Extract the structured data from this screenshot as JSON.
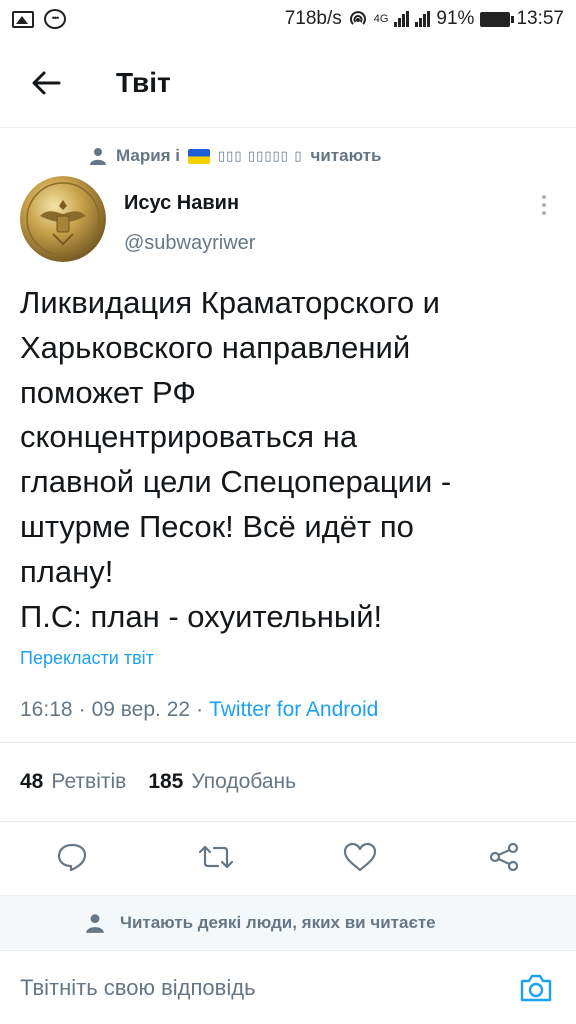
{
  "status_bar": {
    "speed": "718b/s",
    "network": "4G",
    "battery": "91%",
    "time": "13:57"
  },
  "header": {
    "title": "Твіт"
  },
  "social_context": {
    "name": "Мария і",
    "garbled": "▯▯▯ ▯▯▯▯▯ ▯",
    "suffix": "читають"
  },
  "tweet": {
    "author_name": "Исус Навин",
    "author_handle": "@subwayriwer",
    "text": "Ликвидация Краматорского и\nХарьковского направлений\nпоможет РФ\nсконцентрироваться на\nглавной цели Спецоперации -\nштурме Песок! Всё идёт по\nплану!\nП.С: план - охуительный!",
    "translate_label": "Перекласти твіт",
    "time": "16:18",
    "date": "09 вер. 22",
    "source": "Twitter for Android",
    "separator": "·"
  },
  "stats": {
    "retweets_count": "48",
    "retweets_label": "Ретвітів",
    "likes_count": "185",
    "likes_label": "Уподобань"
  },
  "followed_by": {
    "text": "Читають деякі люди, яких ви читаєте"
  },
  "reply": {
    "placeholder": "Твітніть свою відповідь"
  },
  "colors": {
    "accent": "#1da1f2",
    "secondary_text": "#657786",
    "primary_text": "#14171a",
    "divider": "#e6ecf0"
  },
  "icons": [
    "image-icon",
    "message-icon",
    "hotspot-icon",
    "signal-icon",
    "battery-icon",
    "back-arrow-icon",
    "person-icon",
    "more-vertical-icon",
    "reply-icon",
    "retweet-icon",
    "like-icon",
    "share-icon",
    "camera-icon"
  ]
}
